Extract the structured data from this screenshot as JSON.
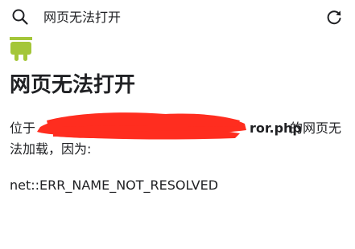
{
  "topbar": {
    "title": "网页无法打开",
    "search_icon": "search-icon",
    "reload_icon": "reload-icon"
  },
  "page": {
    "mascot_icon": "android-icon",
    "heading": "网页无法打开",
    "desc_prefix": "位于",
    "url_tail": "ror.php",
    "desc_suffix": "的网页无",
    "desc_line2": "法加载，因为:",
    "error_code": "net::ERR_NAME_NOT_RESOLVED"
  },
  "colors": {
    "accent_green": "#a4c639",
    "redaction_red": "#ff2d1f",
    "text": "#202124"
  }
}
